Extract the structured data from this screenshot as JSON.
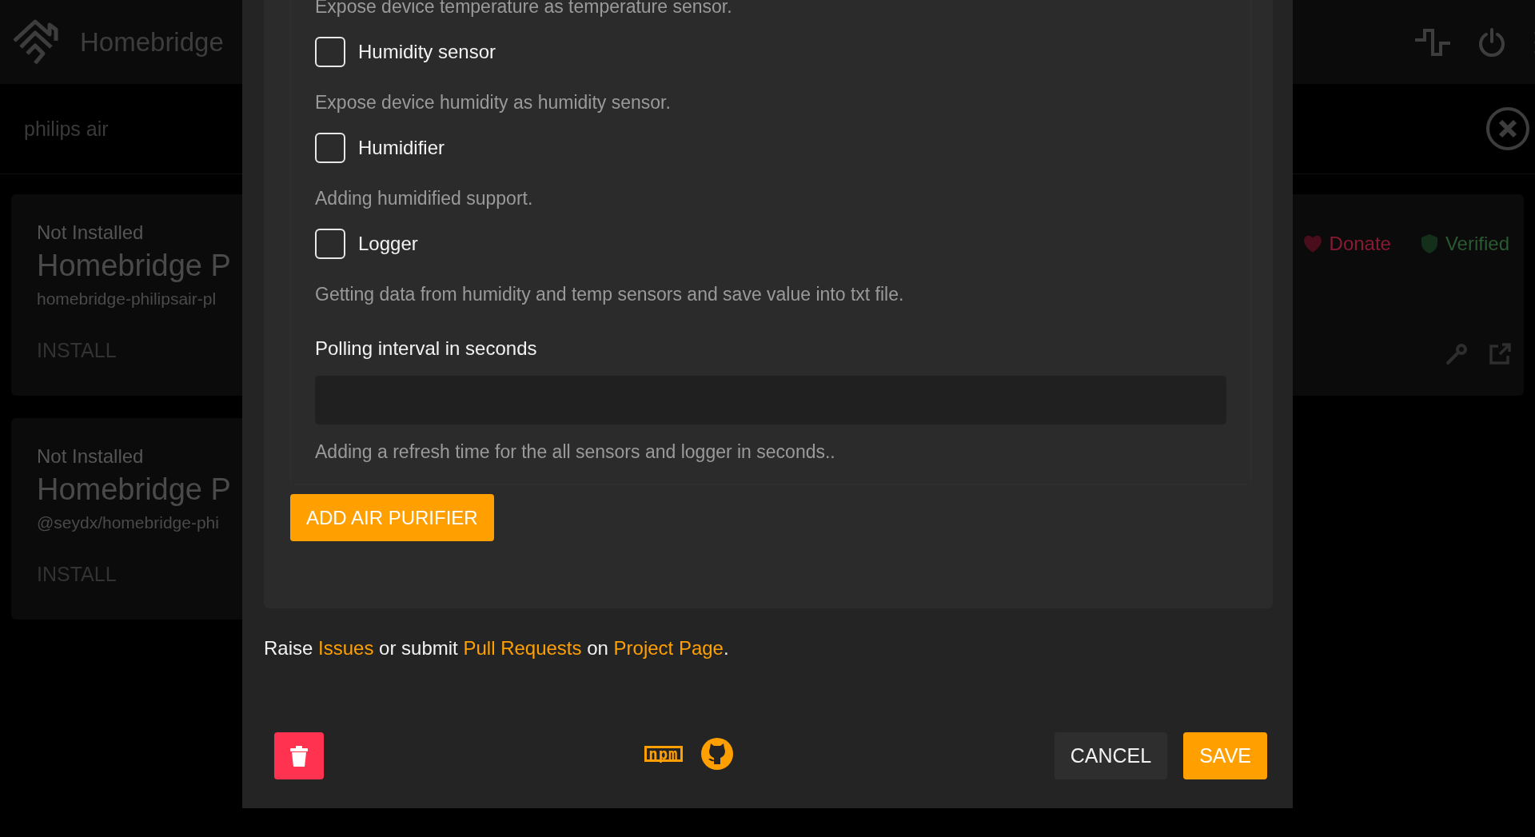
{
  "header": {
    "title": "Homebridge"
  },
  "search": {
    "value": "philips air"
  },
  "plugins": [
    {
      "status": "Not Installed",
      "name": "Homebridge P",
      "package": "homebridge-philipsair-pl",
      "action": "INSTALL",
      "badges": [
        {
          "kind": "donate",
          "label": "Donate"
        },
        {
          "kind": "verified",
          "label": "Verified"
        }
      ]
    },
    {
      "status": "Not Installed",
      "name": "Homebridge P",
      "package": "@seydx/homebridge-phi",
      "action": "INSTALL"
    }
  ],
  "modal": {
    "top_note": "Expose device temperature as temperature sensor.",
    "fields": [
      {
        "kind": "checkbox",
        "label": "Humidity sensor",
        "checked": false,
        "description": "Expose device humidity as humidity sensor."
      },
      {
        "kind": "checkbox",
        "label": "Humidifier",
        "checked": false,
        "description": "Adding humidified support."
      },
      {
        "kind": "checkbox",
        "label": "Logger",
        "checked": false,
        "description": "Getting data from humidity and temp sensors and save value into txt file."
      },
      {
        "kind": "input",
        "label": "Polling interval in seconds",
        "description": "Adding a refresh time for the all sensors and logger in seconds.."
      }
    ],
    "add_button": "ADD AIR PURIFIER",
    "footer_note": [
      {
        "text": "Raise ",
        "link": false
      },
      {
        "text": "Issues",
        "link": true
      },
      {
        "text": " or submit ",
        "link": false
      },
      {
        "text": "Pull Requests",
        "link": true
      },
      {
        "text": " on ",
        "link": false
      },
      {
        "text": "Project Page",
        "link": true
      },
      {
        "text": ".",
        "link": false
      }
    ],
    "npm_label": "npm",
    "cancel": "CANCEL",
    "save": "SAVE"
  }
}
